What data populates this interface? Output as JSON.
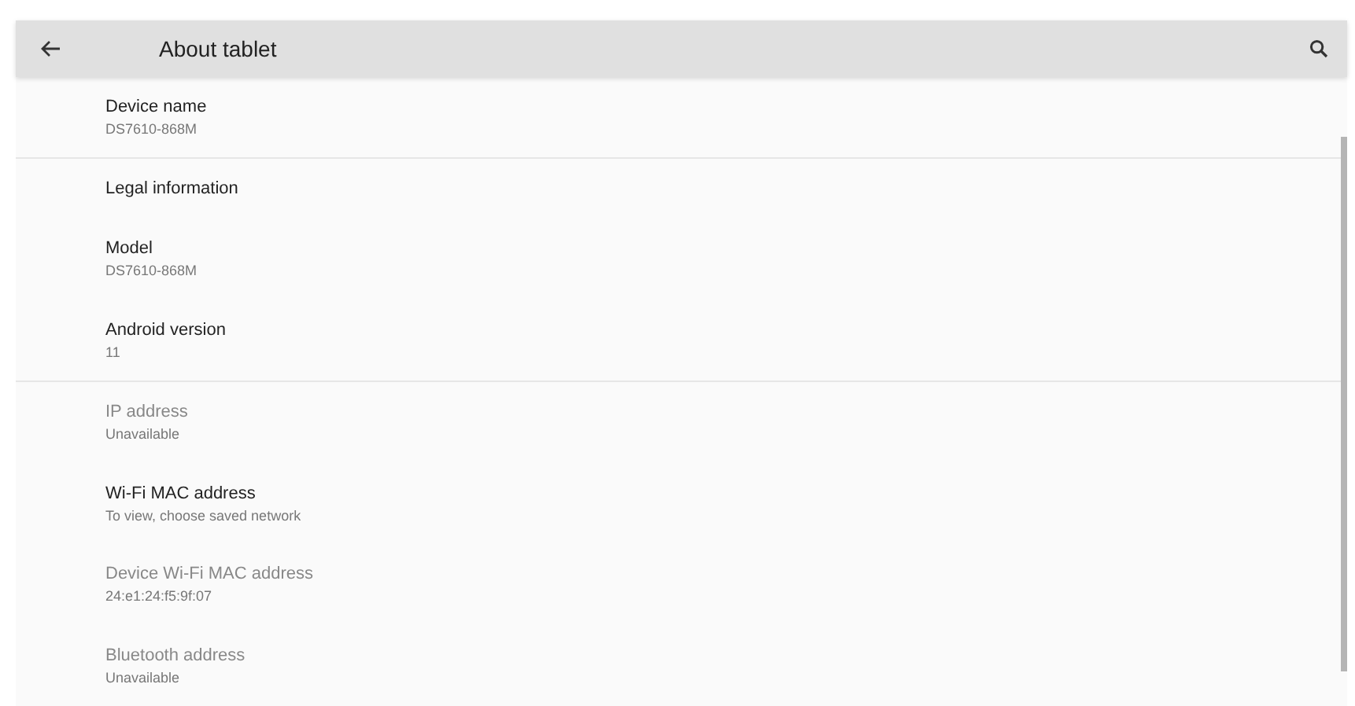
{
  "app_bar": {
    "title": "About tablet"
  },
  "sections": [
    {
      "items": [
        {
          "title": "Device name",
          "summary": "DS7610-868M",
          "disabled": false
        }
      ]
    },
    {
      "items": [
        {
          "title": "Legal information",
          "disabled": false
        },
        {
          "title": "Model",
          "summary": "DS7610-868M",
          "disabled": false
        },
        {
          "title": "Android version",
          "summary": "11",
          "disabled": false
        }
      ]
    },
    {
      "items": [
        {
          "title": "IP address",
          "summary": "Unavailable",
          "disabled": true
        },
        {
          "title": "Wi-Fi MAC address",
          "summary": "To view, choose saved network",
          "disabled": false
        },
        {
          "title": "Device Wi-Fi MAC address",
          "summary": "24:e1:24:f5:9f:07",
          "disabled": true
        },
        {
          "title": "Bluetooth address",
          "summary": "Unavailable",
          "disabled": true
        }
      ]
    }
  ]
}
